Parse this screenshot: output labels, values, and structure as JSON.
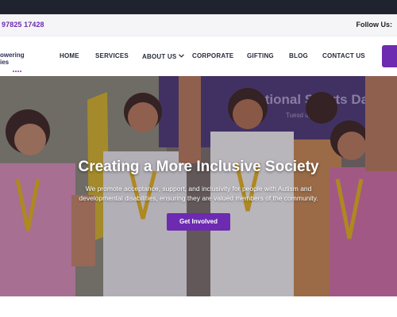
{
  "topbar": {
    "phone": "97825 17428",
    "follow_label": "Follow Us:"
  },
  "logo": {
    "text_line1": "owering",
    "text_line2": "ies"
  },
  "nav": {
    "items": [
      {
        "label": "HOME"
      },
      {
        "label": "SERVICES"
      },
      {
        "label": "ABOUT US"
      },
      {
        "label": "CORPORATE"
      },
      {
        "label": "GIFTING"
      },
      {
        "label": "BLOG"
      },
      {
        "label": "CONTACT US"
      }
    ]
  },
  "hero": {
    "banner_text": "National Sports Da",
    "banner_sub": "Tuesd    ugust 202",
    "title": "Creating a More Inclusive Society",
    "subtitle": "We promote acceptance, support, and inclusivity for people with Autism and developmental disabilities, ensuring they are valued members of the community.",
    "cta_label": "Get Involved"
  },
  "colors": {
    "brand_purple": "#6c2bb1",
    "topbar_bg": "#f5f4f7",
    "chrome_dark": "#1f2330"
  }
}
